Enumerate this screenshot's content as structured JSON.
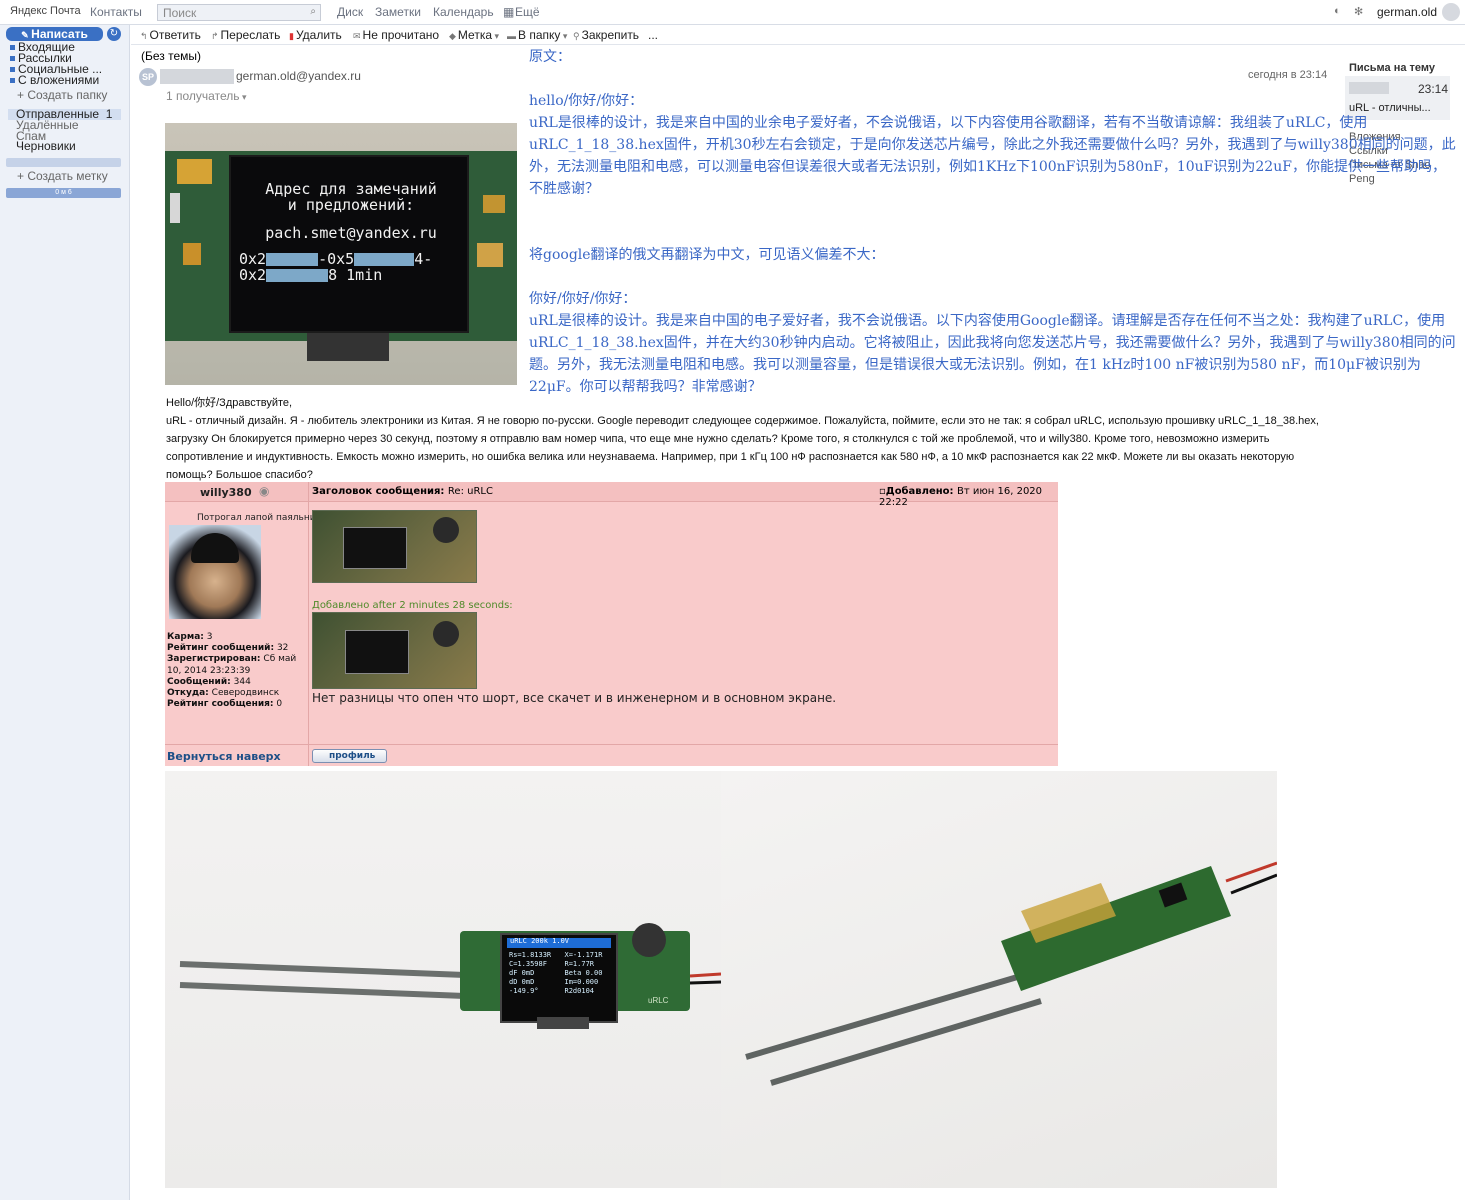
{
  "header": {
    "logo": "Яндекс Почта",
    "nav": [
      "Контакты",
      "Диск",
      "Заметки",
      "Календарь",
      "Ещё"
    ],
    "search_placeholder": "Поиск",
    "user": "german.old"
  },
  "sidebar": {
    "compose_label": "Написать",
    "folders_top": [
      "Входящие",
      "Рассылки",
      "Социальные ...",
      "С вложениями"
    ],
    "create_folder": "Создать папку",
    "folders": [
      {
        "label": "Отправленные",
        "count": "1"
      },
      {
        "label": "Удалённые"
      },
      {
        "label": "Спам"
      },
      {
        "label": "Черновики"
      }
    ],
    "create_label": "Создать метку",
    "bar_text": "0 м 6"
  },
  "toolbar": {
    "items": [
      "Ответить",
      "Переслать",
      "Удалить",
      "Не прочитано",
      "Метка",
      "В папку",
      "Закрепить",
      "..."
    ]
  },
  "message": {
    "subject": "(Без темы)",
    "avatar_initials": "SP",
    "sender_email": "german.old@yandex.ru",
    "recipients": "1 получатель",
    "date": "сегодня в 23:14",
    "image_text": {
      "line1": "Адрес для замечаний",
      "line2": "и предложений:",
      "line3": "pach.smet@yandex.ru",
      "line4": "0x2",
      "line4b": "-0x5",
      "line4c": "4-",
      "line5": "0x2",
      "line5b": "8 1min"
    },
    "cn_blocks": [
      "原文：",
      "",
      "hello/你好/你好：",
      "uRL是很棒的设计，我是来自中国的业余电子爱好者，不会说俄语，以下内容使用谷歌翻译，若有不当敬请谅解：我组装了uRLC，使用uRLC_1_18_38.hex固件，开机30秒左右会锁定，于是向你发送芯片编号，除此之外我还需要做什么吗？另外，我遇到了与willy380相同的问题，此外，无法测量电阻和电感，可以测量电容但误差很大或者无法识别，例如1KHz下100nF识别为580nF，10uF识别为22uF，你能提供一些帮助吗，不胜感谢？",
      "",
      "",
      "将google翻译的俄文再翻译为中文，可见语义偏差不大：",
      "",
      "你好/你好/你好：",
      "uRL是很棒的设计。我是来自中国的电子爱好者，我不会说俄语。以下内容使用Google翻译。请理解是否存在任何不当之处：我构建了uRLC，使用uRLC_1_18_38.hex固件，并在大约30秒钟内启动。它将被阻止，因此我将向您发送芯片号，我还需要做什么？另外，我遇到了与willy380相同的问题。另外，我无法测量电阻和电感。我可以测量容量，但是错误很大或无法识别。例如，在1 kHz时100 nF被识别为580 nF，而10μF被识别为22μF。你可以帮帮我吗？非常感谢？"
    ],
    "ru_greeting": "Hello/你好/Здравствуйте,",
    "ru_body": "uRL - отличный дизайн. Я - любитель электроники из Китая. Я не говорю по-русски. Google переводит следующее содержимое. Пожалуйста, поймите, если это не так: я собрал uRLC, использую прошивку uRLC_1_18_38.hex, загрузку Он блокируется примерно через 30 секунд, поэтому я отправлю вам номер чипа, что еще мне нужно сделать? Кроме того, я столкнулся с той же проблемой, что и willy380. Кроме того, невозможно измерить сопротивление и индуктивность. Емкость можно измерить, но ошибка велика или неузнаваема. Например, при 1 кГц 100 нФ распознается как 580 нФ, а 10 мкФ распознается как 22 мкФ. Можете ли вы оказать некоторую помощь? Большое спасибо?"
  },
  "side_panel": {
    "title": "Письма на тему",
    "time": "23:14",
    "snippet": "uRL - отличны...",
    "links": [
      "Вложения",
      "Ссылки",
      "Письма от Shao",
      "Peng"
    ]
  },
  "forum": {
    "username": "willy380",
    "subject_label": "Заголовок сообщения:",
    "subject_value": "Re: uRLC",
    "added_label": "Добавлено:",
    "added_value": "Вт июн 16, 2020 22:22",
    "rank": "Потрогал лапой паяльник",
    "stats": [
      {
        "k": "Карма:",
        "v": "3"
      },
      {
        "k": "Рейтинг сообщений:",
        "v": "32"
      },
      {
        "k": "Зарегистрирован:",
        "v": "Сб май 10, 2014 23:23:39"
      },
      {
        "k": "Сообщений:",
        "v": "344"
      },
      {
        "k": "Откуда:",
        "v": "Северодвинск"
      },
      {
        "k": "Рейтинг сообщения:",
        "v": "0"
      }
    ],
    "added_after": "Добавлено after 2 minutes 28 seconds:",
    "post_text": "Нет разницы что опен что шорт, все скачет и в инженерном и в основном экране.",
    "back_to_top": "Вернуться наверх",
    "profile_button": "профиль"
  },
  "photos": {
    "left_screen_header": "uRLC  200k  1.0V",
    "left_screen_lines": [
      "Rs=1.8133R",
      "X=-1.171R",
      "C=1.3598F",
      "R=1.77R",
      "dF 0mD",
      "Beta 0.00",
      "dD 0mD",
      "Im=0.000",
      "-149.9°",
      "R2d0104"
    ],
    "left_board_label": "uRLC"
  }
}
